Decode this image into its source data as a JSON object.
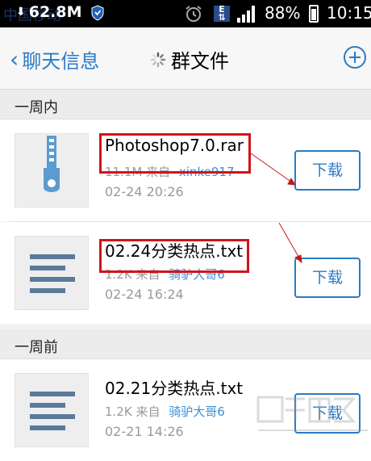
{
  "status_bar": {
    "carrier": "中国移动",
    "ram": "62.8M",
    "battery": "88%",
    "time": "10:15"
  },
  "nav": {
    "back_label": "聊天信息",
    "title": "群文件"
  },
  "sections": [
    {
      "label": "一周内",
      "files": [
        {
          "name": "Photoshop7.0.rar",
          "size": "11.1M",
          "from_label": "来自",
          "uploader": "xinke917",
          "date": "02-24 20:26",
          "action": "下载",
          "icon": "zip-icon"
        },
        {
          "name": "02.24分类热点.txt",
          "size": "1.2K",
          "from_label": "来自",
          "uploader": "骑驴大哥6",
          "date": "02-24 16:24",
          "action": "下载",
          "icon": "text-file-icon"
        }
      ]
    },
    {
      "label": "一周前",
      "files": [
        {
          "name": "02.21分类热点.txt",
          "size": "1.2K",
          "from_label": "来自",
          "uploader": "骑驴大哥6",
          "date": "02-21 14:26",
          "action": "下载",
          "icon": "text-file-icon"
        }
      ]
    }
  ],
  "colors": {
    "accent": "#2a7bc4",
    "annotation": "#d0141b"
  }
}
